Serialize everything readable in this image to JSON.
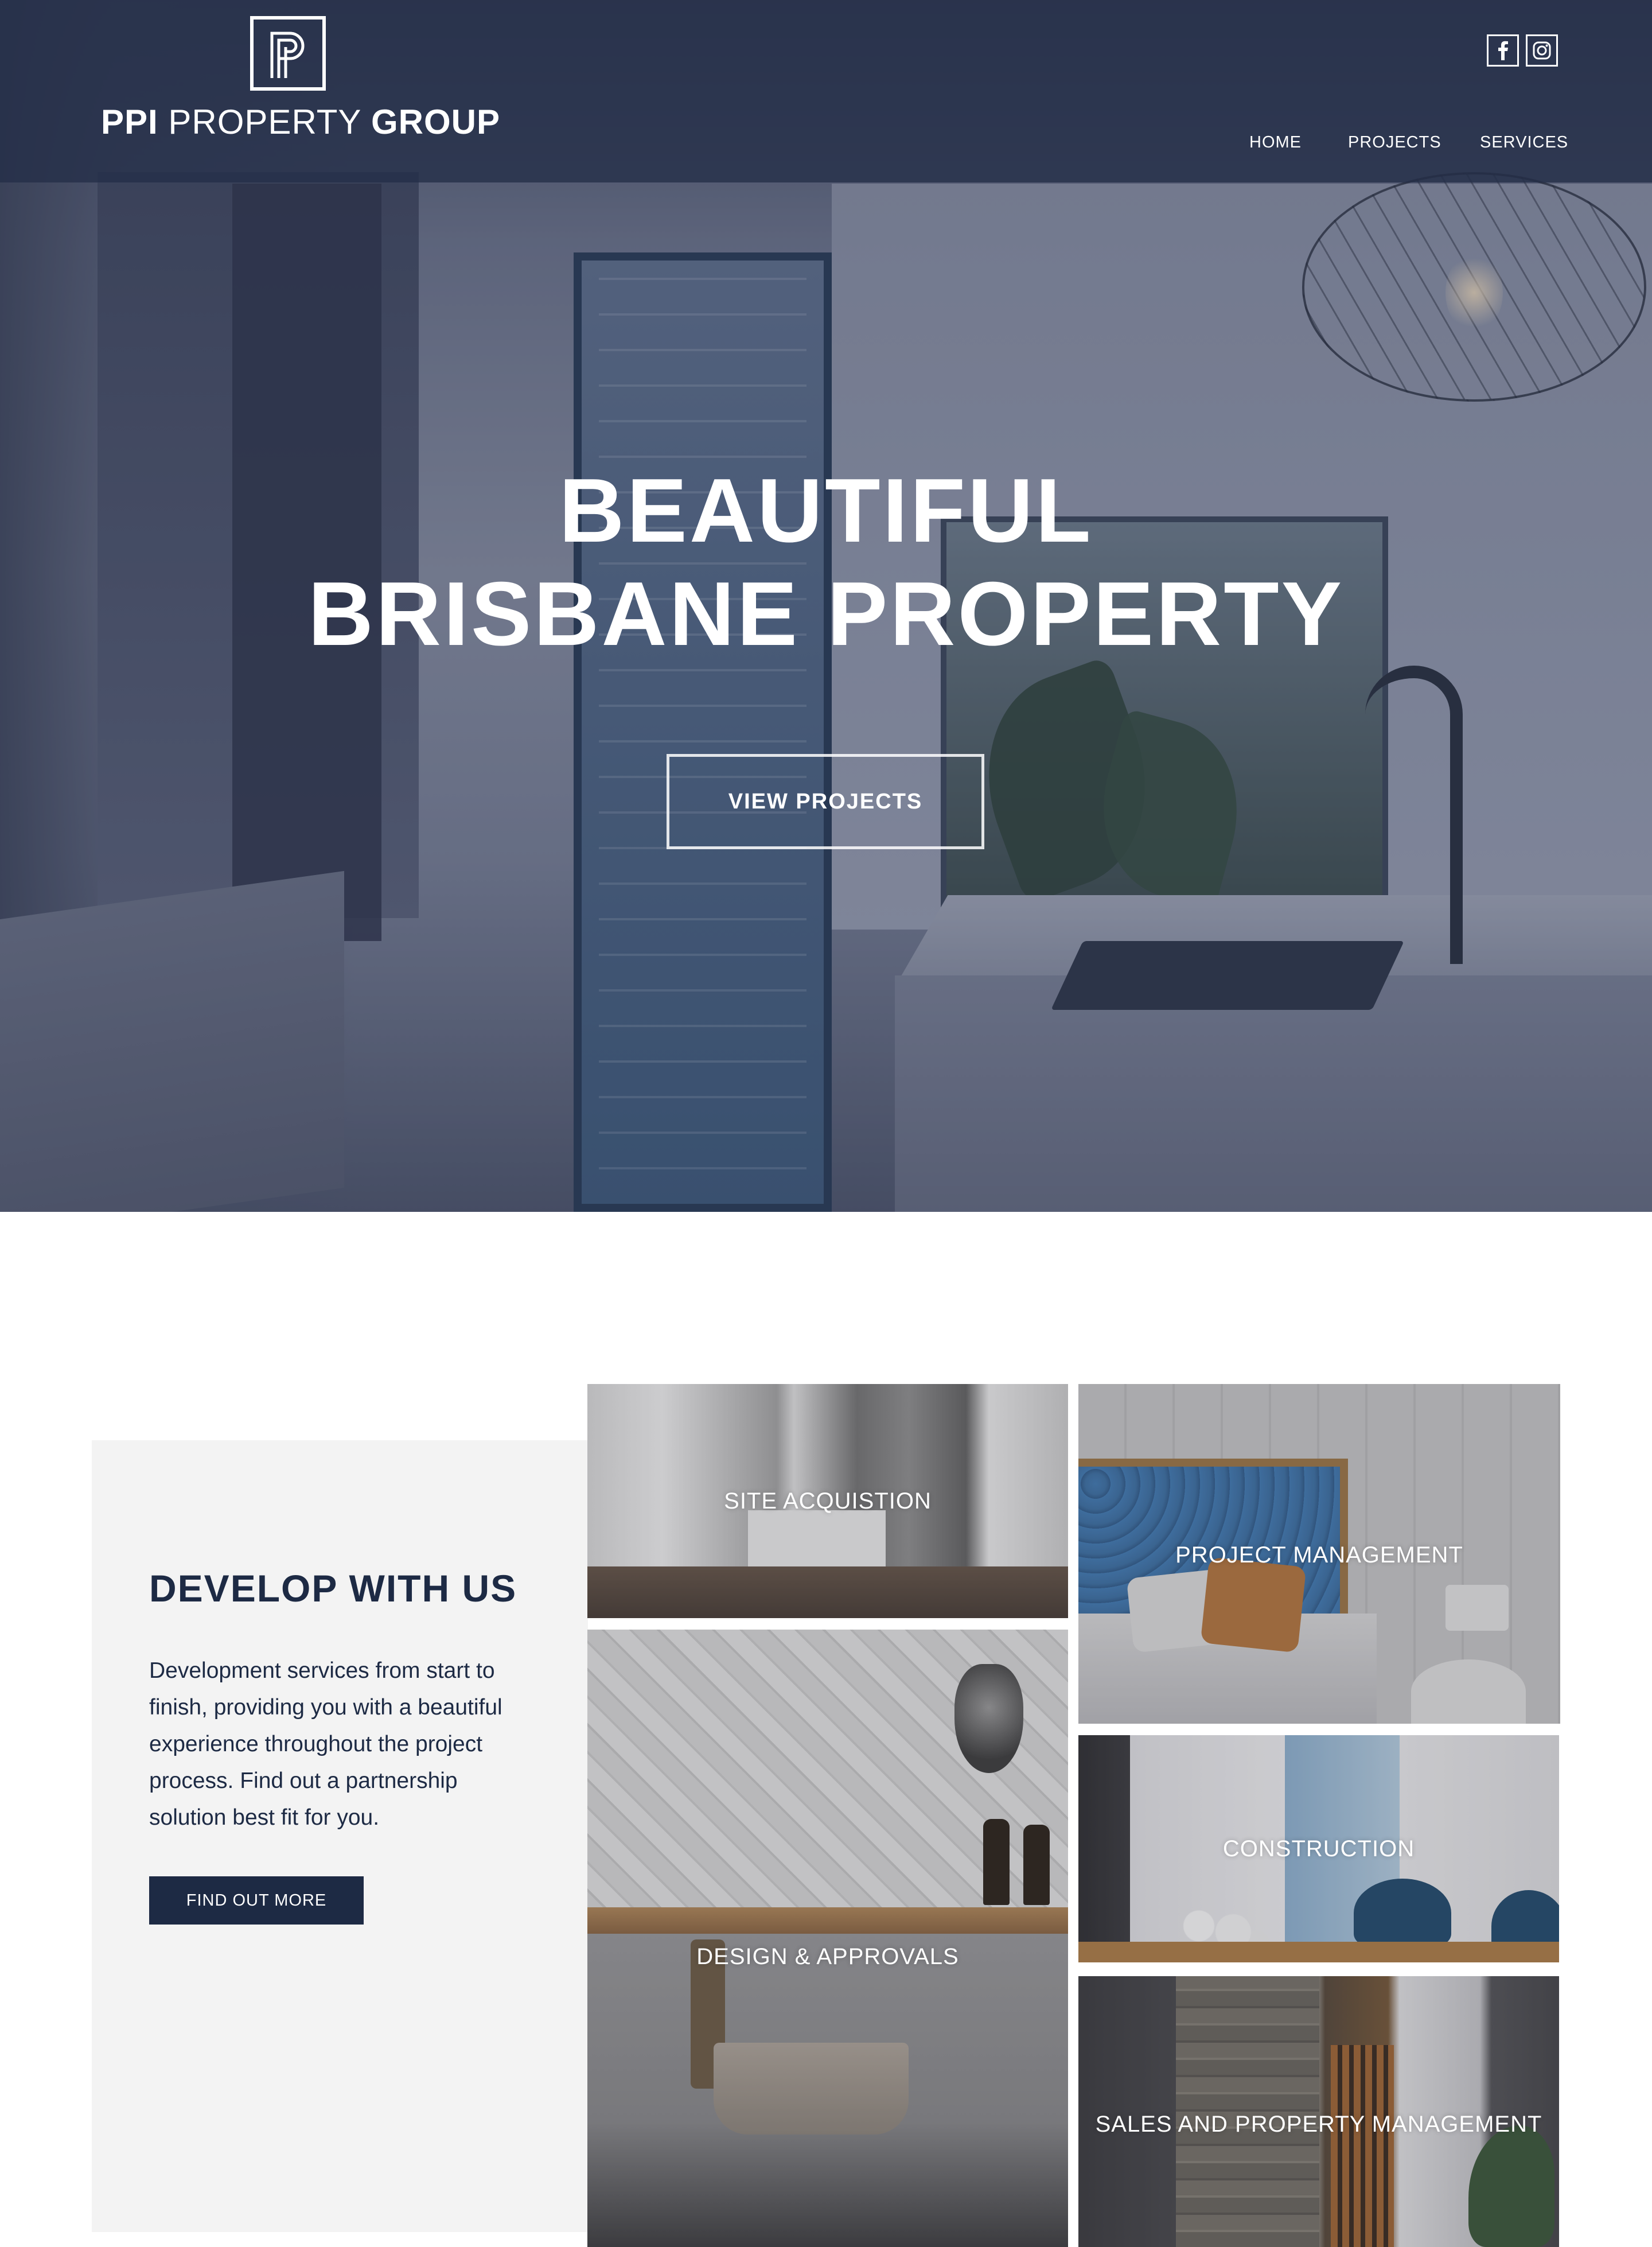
{
  "brand": {
    "name_bold": "PPI",
    "name_light": "PROPERTY",
    "name_end": "GROUP",
    "mark_letter": "P"
  },
  "social": [
    {
      "name": "facebook",
      "icon": "facebook-icon",
      "glyph": "f"
    },
    {
      "name": "instagram",
      "icon": "instagram-icon"
    }
  ],
  "nav": {
    "items": [
      "HOME",
      "PROJECTS",
      "SERVICES"
    ]
  },
  "hero": {
    "title_line1": "BEAUTIFUL",
    "title_line2": "BRISBANE PROPERTY",
    "cta_label": "VIEW PROJECTS"
  },
  "develop": {
    "title": "DEVELOP WITH US",
    "body": "Development services from start to finish, providing you with a beautiful experience throughout the project process. Find out a partnership solution best fit for you.",
    "cta_label": "FIND OUT MORE"
  },
  "services": {
    "site": "SITE ACQUISTION",
    "project_management": "PROJECT MANAGEMENT",
    "design": "DESIGN & APPROVALS",
    "construction": "CONSTRUCTION",
    "sales": "SALES AND PROPERTY MANAGEMENT"
  },
  "colors": {
    "navy": "#1d2a44",
    "header_overlay": "#242e48",
    "panel_gray": "#f3f3f3",
    "white": "#ffffff"
  }
}
